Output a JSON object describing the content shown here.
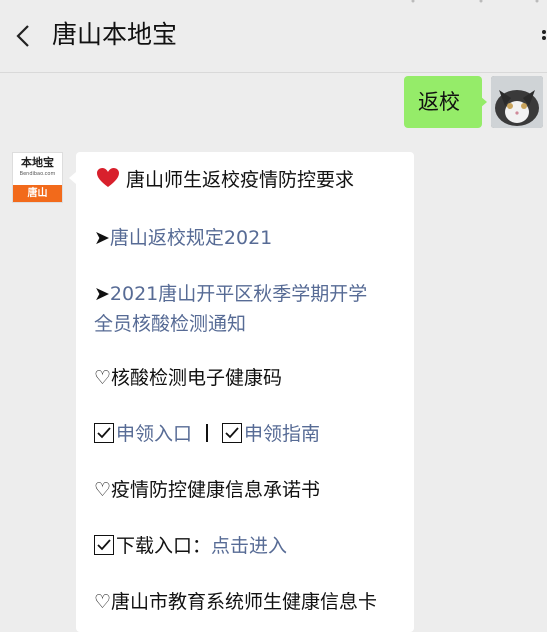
{
  "header": {
    "title": "唐山本地宝"
  },
  "outgoing": {
    "text": "返校"
  },
  "bot": {
    "logo_top": "本地宝",
    "logo_url": "Bendibao.com",
    "logo_bottom": "唐山"
  },
  "message": {
    "heading": "唐山师生返校疫情防控要求",
    "link1_prefix": "➤",
    "link1": "唐山返校规定2021",
    "link2_prefix": "➤",
    "link2_line1": "2021唐山开平区秋季学期开学",
    "link2_line2": "全员核酸检测通知",
    "section1": "♡核酸检测电子健康码",
    "apply_entry": "申领入口",
    "apply_guide": "申领指南",
    "section2": "♡疫情防控健康信息承诺书",
    "download_label": "下载入口：",
    "download_link": "点击进入",
    "section3": "♡唐山市教育系统师生健康信息卡"
  },
  "colors": {
    "bubble_out": "#95ec69",
    "link": "#576b95",
    "logo_orange": "#f26a1b"
  }
}
